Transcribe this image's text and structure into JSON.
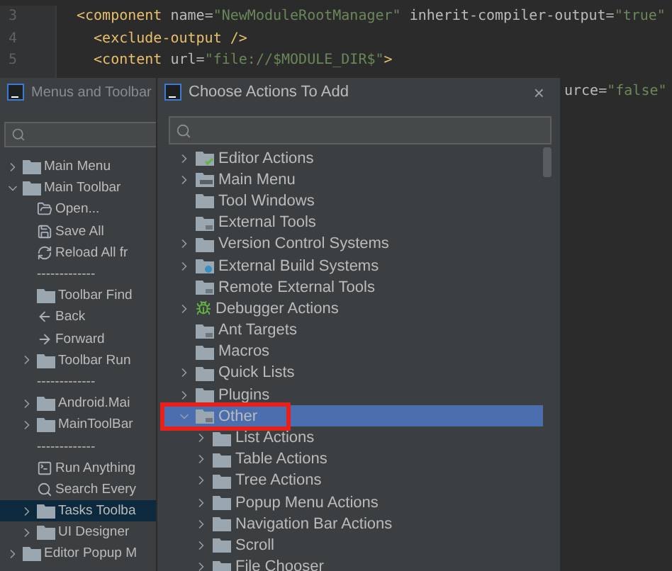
{
  "editor": {
    "lines": [
      {
        "number": "3",
        "tokens": [
          {
            "kind": "tag",
            "text": "<component "
          },
          {
            "kind": "attr",
            "text": "name="
          },
          {
            "kind": "value",
            "text": "\"NewModuleRootManager\" "
          },
          {
            "kind": "attr",
            "text": "inherit-compiler-output="
          },
          {
            "kind": "value",
            "text": "\"true\""
          }
        ]
      },
      {
        "number": "4",
        "tokens": [
          {
            "kind": "tag",
            "text": "  <exclude-output />"
          }
        ]
      },
      {
        "number": "5",
        "tokens": [
          {
            "kind": "tag",
            "text": "  <content "
          },
          {
            "kind": "attr",
            "text": "url="
          },
          {
            "kind": "value",
            "text": "\"file://$MODULE_DIR$\""
          },
          {
            "kind": "tag",
            "text": ">"
          }
        ]
      }
    ],
    "fragment": [
      {
        "kind": "attr",
        "text": "urce="
      },
      {
        "kind": "value",
        "text": "\"false\""
      }
    ]
  },
  "menus_dialog": {
    "title": "Menus and Toolbar",
    "tree": [
      {
        "label": "Main Menu",
        "kind": "folder",
        "expanded": false,
        "selected": false
      },
      {
        "label": "Main Toolbar",
        "kind": "folder",
        "expanded": true,
        "selected": false,
        "children": [
          {
            "label": "Open...",
            "kind": "open",
            "selected": false
          },
          {
            "label": "Save All",
            "kind": "save",
            "selected": false
          },
          {
            "label": "Reload All fr",
            "kind": "reload",
            "selected": false
          },
          {
            "label": "-------------",
            "kind": "separator",
            "selected": false
          },
          {
            "label": "Toolbar Find",
            "kind": "folder",
            "selected": false
          },
          {
            "label": "Back",
            "kind": "back",
            "selected": false
          },
          {
            "label": "Forward",
            "kind": "forward",
            "selected": false
          },
          {
            "label": "Toolbar Run",
            "kind": "folder",
            "expanded": false,
            "selected": false
          },
          {
            "label": "-------------",
            "kind": "separator",
            "selected": false
          },
          {
            "label": "Android.Mai",
            "kind": "folder",
            "expanded": false,
            "selected": false
          },
          {
            "label": "MainToolBar",
            "kind": "folder",
            "expanded": false,
            "selected": false
          },
          {
            "label": "-------------",
            "kind": "separator",
            "selected": false
          },
          {
            "label": "Run Anything",
            "kind": "terminal",
            "selected": false
          },
          {
            "label": "Search Every",
            "kind": "search",
            "selected": false
          },
          {
            "label": "Tasks Toolba",
            "kind": "folder",
            "expanded": false,
            "selected": true
          },
          {
            "label": "UI Designer",
            "kind": "folder",
            "expanded": false,
            "selected": false
          }
        ]
      },
      {
        "label": "Editor Popup M",
        "kind": "folder",
        "expanded": false,
        "selected": false
      }
    ]
  },
  "actions_dialog": {
    "title": "Choose Actions To Add",
    "close": "×",
    "tree": [
      {
        "label": "Editor Actions",
        "kind": "folder-check",
        "expanded": false,
        "selected": false
      },
      {
        "label": "Main Menu",
        "kind": "folder-menu",
        "expanded": false,
        "selected": false
      },
      {
        "label": "Tool Windows",
        "kind": "folder",
        "selected": false
      },
      {
        "label": "External Tools",
        "kind": "folder-tools",
        "selected": false
      },
      {
        "label": "Version Control Systems",
        "kind": "folder",
        "expanded": false,
        "selected": false
      },
      {
        "label": "External Build Systems",
        "kind": "folder-gear",
        "expanded": false,
        "selected": false
      },
      {
        "label": "Remote External Tools",
        "kind": "folder-tools",
        "selected": false
      },
      {
        "label": "Debugger Actions",
        "kind": "bug",
        "expanded": false,
        "selected": false
      },
      {
        "label": "Ant Targets",
        "kind": "folder-tools",
        "selected": false
      },
      {
        "label": "Macros",
        "kind": "folder",
        "selected": false
      },
      {
        "label": "Quick Lists",
        "kind": "folder",
        "expanded": false,
        "selected": false
      },
      {
        "label": "Plugins",
        "kind": "folder",
        "expanded": false,
        "selected": false
      },
      {
        "label": "Other",
        "kind": "folder-tools",
        "expanded": true,
        "selected": true,
        "children": [
          {
            "label": "List Actions",
            "kind": "folder",
            "expanded": false,
            "selected": false
          },
          {
            "label": "Table Actions",
            "kind": "folder",
            "expanded": false,
            "selected": false
          },
          {
            "label": "Tree Actions",
            "kind": "folder",
            "expanded": false,
            "selected": false
          },
          {
            "label": "Popup Menu Actions",
            "kind": "folder",
            "expanded": false,
            "selected": false
          },
          {
            "label": "Navigation Bar Actions",
            "kind": "folder",
            "expanded": false,
            "selected": false
          },
          {
            "label": "Scroll",
            "kind": "folder",
            "expanded": false,
            "selected": false
          },
          {
            "label": "File Chooser",
            "kind": "folder",
            "expanded": false,
            "selected": false
          }
        ]
      }
    ]
  }
}
